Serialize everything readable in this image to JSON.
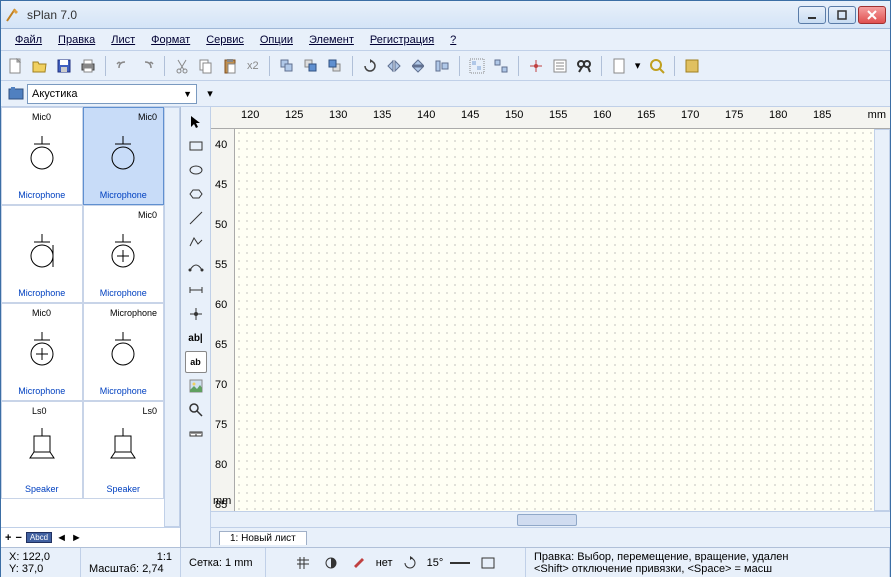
{
  "window": {
    "title": "sPlan 7.0"
  },
  "menu": [
    "Файл",
    "Правка",
    "Лист",
    "Формат",
    "Сервис",
    "Опции",
    "Элемент",
    "Регистрация",
    "?"
  ],
  "library": {
    "selected": "Акустика"
  },
  "palette": {
    "items": [
      {
        "label": "Microphone",
        "tag": "Mic0",
        "sel": false
      },
      {
        "label": "Microphone",
        "tag": "Mic0",
        "sel": true
      },
      {
        "label": "Microphone",
        "tag": "",
        "sel": false
      },
      {
        "label": "Microphone",
        "tag": "Mic0",
        "sel": false
      },
      {
        "label": "Microphone",
        "tag": "Mic0",
        "sel": false
      },
      {
        "label": "Microphone",
        "tag": "Microphone",
        "sel": false
      },
      {
        "label": "Speaker",
        "tag": "Ls0",
        "sel": false
      },
      {
        "label": "Speaker",
        "tag": "Ls0",
        "sel": false
      }
    ]
  },
  "ruler": {
    "h_ticks": [
      120,
      125,
      130,
      135,
      140,
      145,
      150,
      155,
      160,
      165,
      170,
      175,
      180,
      185
    ],
    "h_unit": "mm",
    "v_ticks": [
      40,
      45,
      50,
      55,
      60,
      65,
      70,
      75,
      80,
      85
    ],
    "v_unit": "mm"
  },
  "tab": {
    "label": "1: Новый лист"
  },
  "status": {
    "x": "X: 122,0",
    "y": "Y: 37,0",
    "ratio": "1:1",
    "scale_label": "Масштаб:",
    "scale_val": "2,74",
    "grid_label": "Сетка:",
    "grid_val": "1 mm",
    "text2": "нет",
    "angle": "15°",
    "hint": "Правка: Выбор, перемещение, вращение, удален",
    "hint2": "<Shift> отключение привязки, <Space> = масш"
  }
}
